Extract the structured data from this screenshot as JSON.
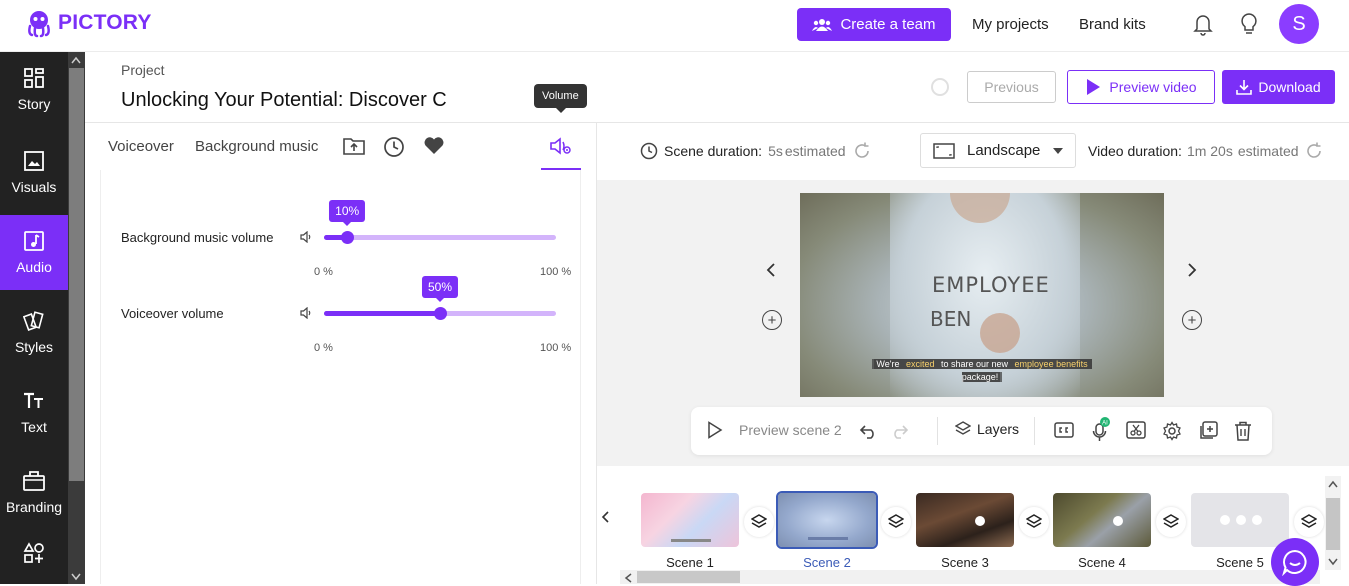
{
  "app": {
    "logo_text": "PICTORY"
  },
  "header": {
    "create_team": "Create a team",
    "my_projects": "My projects",
    "brand_kits": "Brand kits",
    "avatar_initial": "S"
  },
  "sidebar": {
    "items": [
      {
        "label": "Story",
        "icon": "grid-icon"
      },
      {
        "label": "Visuals",
        "icon": "image-icon"
      },
      {
        "label": "Audio",
        "icon": "music-icon",
        "active": true
      },
      {
        "label": "Styles",
        "icon": "styles-icon"
      },
      {
        "label": "Text",
        "icon": "text-icon"
      },
      {
        "label": "Branding",
        "icon": "briefcase-icon"
      }
    ]
  },
  "project": {
    "label": "Project",
    "title": "Unlocking Your Potential: Discover C"
  },
  "actions": {
    "previous": "Previous",
    "preview_video": "Preview video",
    "download": "Download"
  },
  "tooltip": {
    "text": "Volume"
  },
  "audio_tabs": {
    "voiceover": "Voiceover",
    "background_music": "Background music"
  },
  "volume": {
    "background": {
      "label": "Background music volume",
      "value": 10,
      "badge": "10%",
      "min": "0 %",
      "max": "100 %"
    },
    "voiceover": {
      "label": "Voiceover volume",
      "value": 50,
      "badge": "50%",
      "min": "0 %",
      "max": "100 %"
    }
  },
  "scene_info": {
    "scene_duration_label": "Scene duration:",
    "scene_duration_value": "5s",
    "scene_duration_est": "estimated",
    "orientation": "Landscape",
    "video_duration_label": "Video duration:",
    "video_duration_value": "1m 20s",
    "video_duration_est": "estimated"
  },
  "preview": {
    "overlay_line1": "EMPLOYEE",
    "overlay_line2": "BEN",
    "caption_a": "We're ",
    "caption_b": "excited",
    "caption_c": " to share our new ",
    "caption_d": "employee benefits",
    "caption_e": " package!"
  },
  "toolbar": {
    "preview_scene": "Preview scene 2",
    "layers": "Layers",
    "ai_badge": "AI"
  },
  "timeline": {
    "scenes": [
      {
        "label": "Scene 1"
      },
      {
        "label": "Scene 2",
        "selected": true
      },
      {
        "label": "Scene 3"
      },
      {
        "label": "Scene 4"
      },
      {
        "label": "Scene 5"
      }
    ]
  },
  "colors": {
    "accent": "#7b2ff7",
    "sidebar": "#222222",
    "selected_scene": "#3b5bb7"
  }
}
